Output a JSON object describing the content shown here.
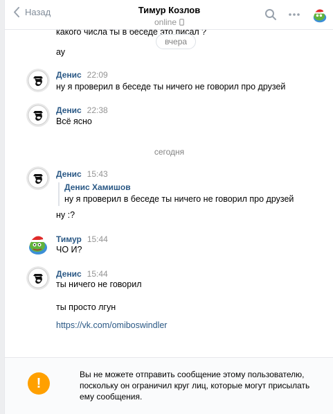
{
  "header": {
    "back_label": "Назад",
    "peer_name": "Тимур Козлов",
    "peer_status": "online"
  },
  "dates": {
    "yesterday": "вчера",
    "today": "сегодня"
  },
  "messages": [
    {
      "text": "какого числа ты в беседе это писал ?"
    },
    {
      "text": "ау"
    },
    {
      "author": "Денис",
      "time": "22:09",
      "text": "ну я проверил в беседе ты ничего не говорил про друзей"
    },
    {
      "author": "Денис",
      "time": "22:38",
      "text": "Всё ясно"
    },
    {
      "author": "Денис",
      "time": "15:43",
      "quote": {
        "author": "Денис Хамишов",
        "text": "ну я проверил в беседе ты ничего не говорил про друзей"
      },
      "text": "ну :?"
    },
    {
      "author": "Тимур",
      "time": "15:44",
      "text": "ЧО И?"
    },
    {
      "author": "Денис",
      "time": "15:44",
      "lines": [
        "ты ничего не говорил",
        "ты просто лгун"
      ],
      "link": "https://vk.com/omiboswindler"
    }
  ],
  "footer": {
    "notice": "Вы не можете отправить сообщение этому пользователю, поскольку он ограничил круг лиц, которые могут присылать ему сообщения.",
    "warn_symbol": "!"
  },
  "colors": {
    "link": "#2a5885",
    "muted": "#939393",
    "warning": "#ffa000"
  },
  "icons": [
    "chevron-left-icon",
    "phone-icon",
    "search-icon",
    "more-icon",
    "user-avatar-icon",
    "warning-icon"
  ]
}
